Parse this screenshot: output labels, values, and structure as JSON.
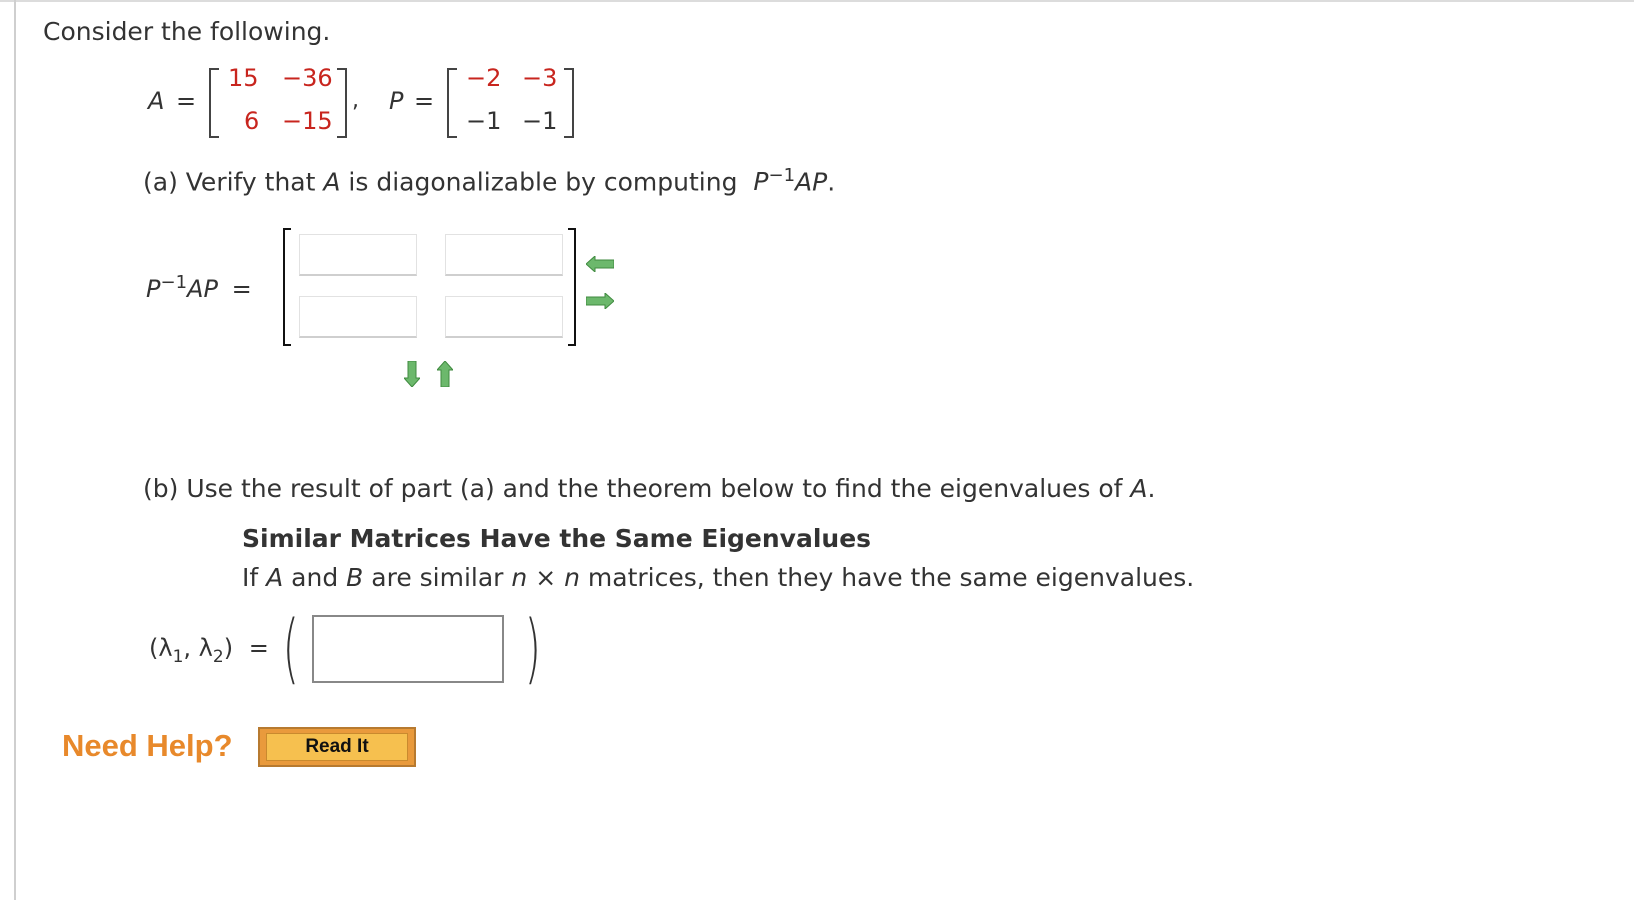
{
  "intro": "Consider the following.",
  "matrix_A": {
    "label": "A",
    "equals": "=",
    "rows": [
      [
        "15",
        "−36"
      ],
      [
        "6",
        "−15"
      ]
    ]
  },
  "comma": ",",
  "matrix_P": {
    "label": "P",
    "equals": "=",
    "rows": [
      [
        "−2",
        "−3"
      ],
      [
        "−1",
        "−1"
      ]
    ]
  },
  "part_a": {
    "text_before": "(a) Verify that ",
    "var": "A",
    "text_after": " is diagonalizable by computing ",
    "expr_P": "P",
    "expr_sup": "−1",
    "expr_AP": "AP",
    "period": ".",
    "answer_label_P": "P",
    "answer_label_sup": "−1",
    "answer_label_AP": "AP",
    "answer_label_eq": "=",
    "cells": [
      "",
      "",
      "",
      ""
    ],
    "controls": {
      "remove_column": "arrow-left-icon",
      "add_column": "arrow-right-icon",
      "add_row": "arrow-down-icon",
      "remove_row": "arrow-up-icon"
    }
  },
  "part_b": {
    "text_before": "(b) Use the result of part (a) and the theorem below to find the eigenvalues of ",
    "var": "A",
    "period": ".",
    "theorem_title": "Similar Matrices Have the Same Eigenvalues",
    "theorem_parts": [
      "If ",
      "A",
      " and ",
      "B",
      " are similar ",
      "n",
      " × ",
      "n",
      " matrices, then they have the same eigenvalues."
    ],
    "answer_label": "(λ",
    "sub1": "1",
    "mid": ", λ",
    "sub2": "2",
    "close": ")",
    "eq": "=",
    "value": ""
  },
  "help": {
    "label": "Need Help?",
    "read_it": "Read It"
  }
}
